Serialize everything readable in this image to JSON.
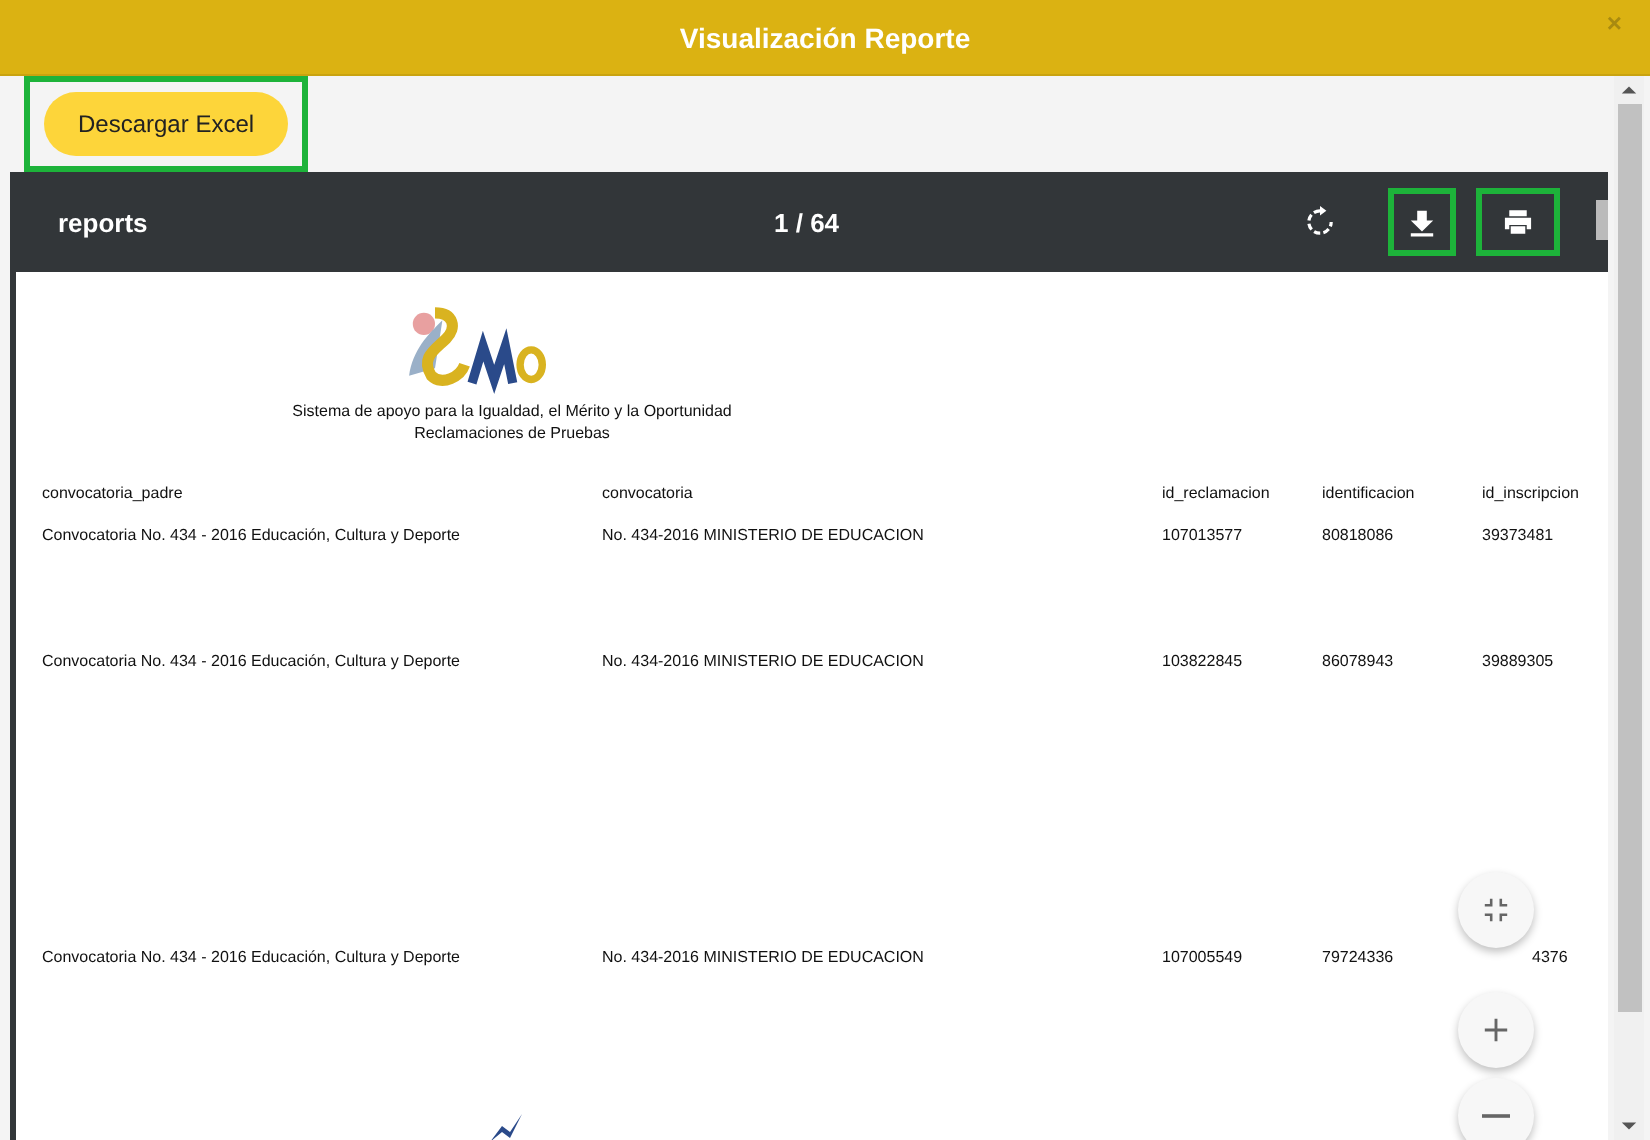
{
  "window": {
    "title": "Visualización Reporte",
    "close": "×"
  },
  "actions": {
    "excel_button": "Descargar Excel"
  },
  "viewer": {
    "title": "reports",
    "page": "1 / 64"
  },
  "report": {
    "subtitle": "Sistema de apoyo para la Igualdad, el Mérito y la Oportunidad",
    "section": "Reclamaciones de Pruebas",
    "columns": [
      "convocatoria_padre",
      "convocatoria",
      "id_reclamacion",
      "identificacion",
      "id_inscripcion"
    ],
    "rows": [
      [
        "Convocatoria No. 434 - 2016 Educación, Cultura y Deporte",
        "No. 434-2016 MINISTERIO DE EDUCACION",
        "107013577",
        "80818086",
        "39373481"
      ],
      [
        "Convocatoria No. 434 - 2016 Educación, Cultura y Deporte",
        "No. 434-2016 MINISTERIO DE EDUCACION",
        "103822845",
        "86078943",
        "39889305"
      ],
      [
        "Convocatoria No. 434 - 2016 Educación, Cultura y Deporte",
        "No. 434-2016 MINISTERIO DE EDUCACION",
        "107005549",
        "79724336",
        "4376"
      ]
    ]
  }
}
